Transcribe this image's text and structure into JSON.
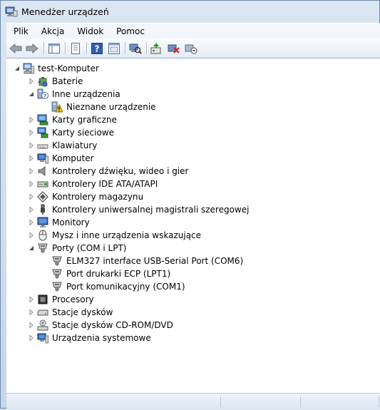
{
  "window": {
    "title": "Menedżer urządzeń"
  },
  "menu": [
    "Plik",
    "Akcja",
    "Widok",
    "Pomoc"
  ],
  "toolbar": {
    "buttons": [
      "back-icon",
      "forward-icon",
      "show-hide-console-tree-icon",
      "properties-icon",
      "help-icon",
      "scan-hardware-icon",
      "update-driver-icon",
      "uninstall-icon",
      "enable-disable-icon"
    ]
  },
  "tree": {
    "root": "test-Komputer",
    "nodes": [
      {
        "label": "Baterie",
        "icon": "battery-icon",
        "expanded": false
      },
      {
        "label": "Inne urządzenia",
        "icon": "unknown-device-category-icon",
        "expanded": true,
        "children": [
          "Nieznane urządzenie"
        ]
      },
      {
        "label": "Karty graficzne",
        "icon": "display-adapter-icon",
        "expanded": false
      },
      {
        "label": "Karty sieciowe",
        "icon": "network-adapter-icon",
        "expanded": false
      },
      {
        "label": "Klawiatury",
        "icon": "keyboard-icon",
        "expanded": false
      },
      {
        "label": "Komputer",
        "icon": "computer-icon",
        "expanded": false
      },
      {
        "label": "Kontrolery dźwięku, wideo i gier",
        "icon": "speaker-icon",
        "expanded": false
      },
      {
        "label": "Kontrolery IDE ATA/ATAPI",
        "icon": "ide-controller-icon",
        "expanded": false
      },
      {
        "label": "Kontrolery magazynu",
        "icon": "storage-controller-icon",
        "expanded": false
      },
      {
        "label": "Kontrolery uniwersalnej magistrali szeregowej",
        "icon": "usb-icon",
        "expanded": false
      },
      {
        "label": "Monitory",
        "icon": "monitor-icon",
        "expanded": false
      },
      {
        "label": "Mysz i inne urządzenia wskazujące",
        "icon": "mouse-icon",
        "expanded": false
      },
      {
        "label": "Porty (COM i LPT)",
        "icon": "port-icon",
        "expanded": true,
        "children": [
          "ELM327 interface USB-Serial Port (COM6)",
          "Port drukarki ECP (LPT1)",
          "Port komunikacyjny (COM1)"
        ]
      },
      {
        "label": "Procesory",
        "icon": "processor-icon",
        "expanded": false
      },
      {
        "label": "Stacje dysków",
        "icon": "disk-drive-icon",
        "expanded": false
      },
      {
        "label": "Stacje dysków CD-ROM/DVD",
        "icon": "cdrom-icon",
        "expanded": false
      },
      {
        "label": "Urządzenia systemowe",
        "icon": "system-device-icon",
        "expanded": false
      }
    ]
  }
}
